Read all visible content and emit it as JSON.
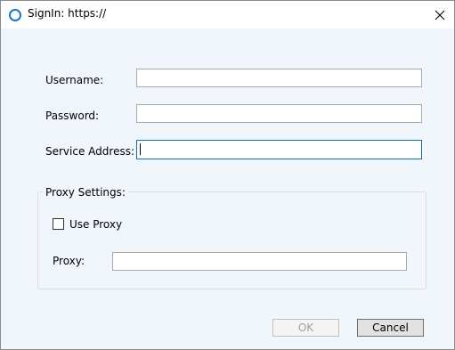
{
  "window": {
    "title": "SignIn: https://",
    "icon": "app-ring-icon",
    "close_icon": "close-icon"
  },
  "form": {
    "username_label": "Username:",
    "username_value": "",
    "password_label": "Password:",
    "password_value": "",
    "service_address_label": "Service Address:",
    "service_address_value": ""
  },
  "proxy": {
    "group_label": "Proxy Settings:",
    "use_proxy_label": "Use Proxy",
    "use_proxy_checked": false,
    "proxy_label": "Proxy:",
    "proxy_value": ""
  },
  "buttons": {
    "ok_label": "OK",
    "ok_enabled": false,
    "cancel_label": "Cancel"
  },
  "colors": {
    "accent": "#0a6fb5",
    "background": "#f0f6fc"
  }
}
